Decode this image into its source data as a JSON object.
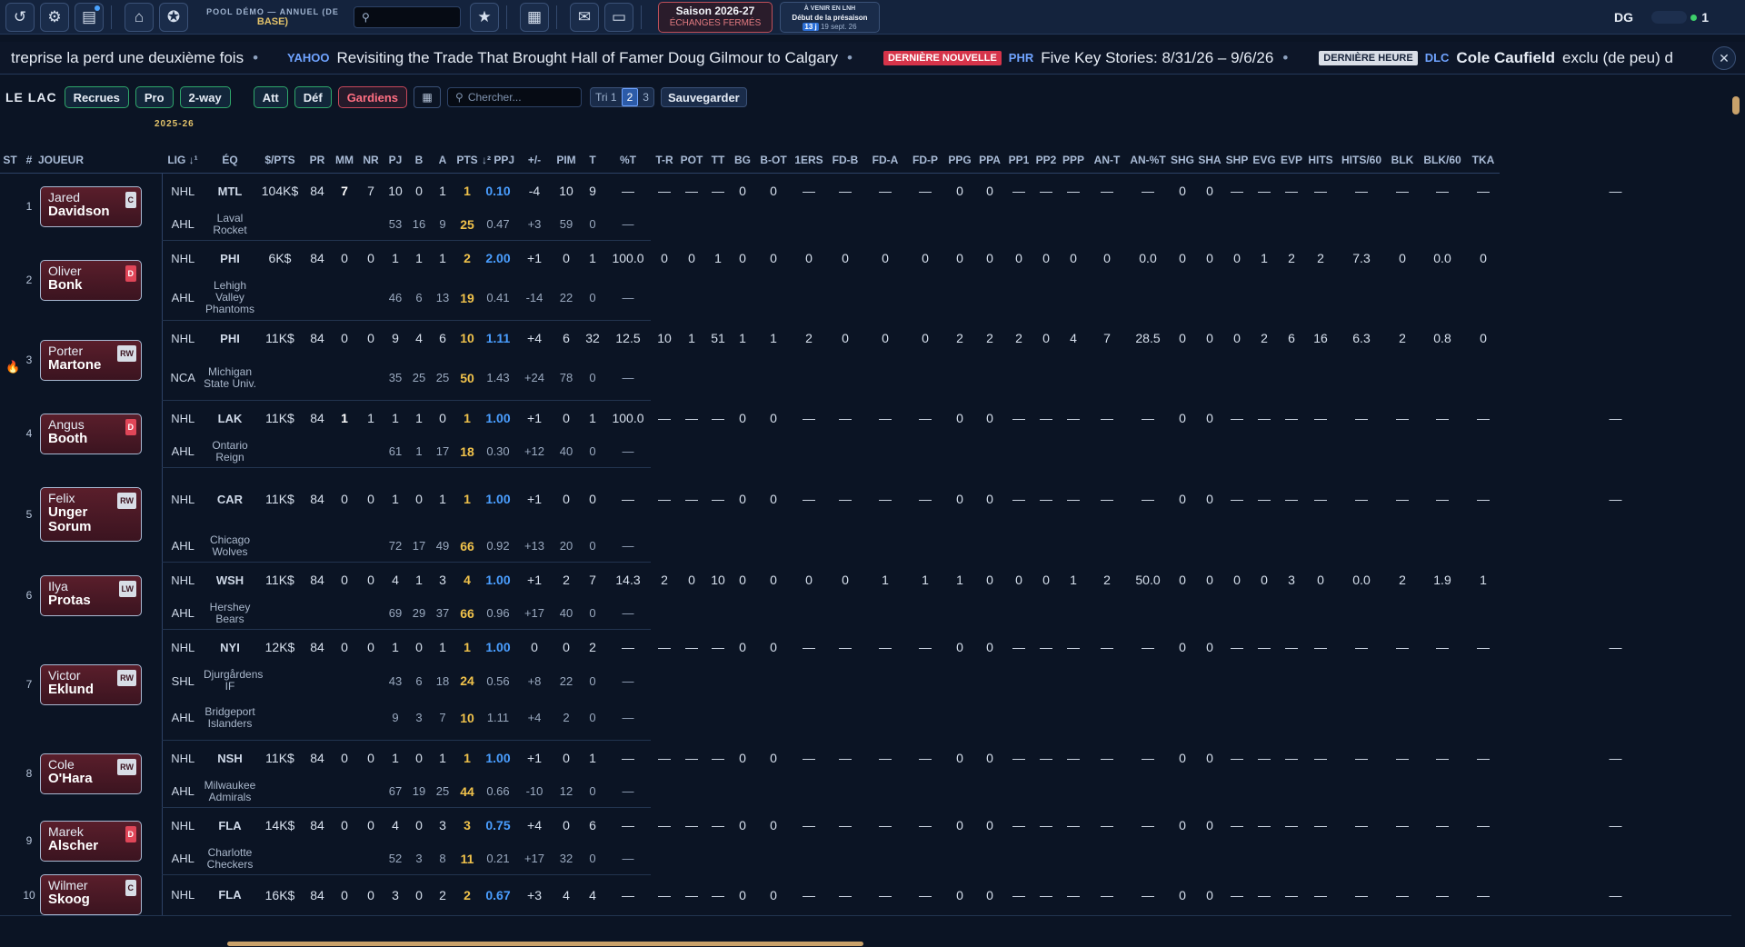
{
  "topbar": {
    "pool_line1": "POOL DÉMO — ANNUEL (DE",
    "pool_line2": "BASE)",
    "season_title": "Saison 2026-27",
    "season_status": "ÉCHANGES FERMÉS",
    "upcoming_title": "À VENIR EN LNH",
    "upcoming_event": "Début de la présaison",
    "upcoming_days": "13 j",
    "upcoming_date": "19 sept. 26",
    "user_initials": "DG",
    "user_count": "1"
  },
  "ticker": {
    "item1_text": "treprise la perd une deuxième fois",
    "item2_source": "YAHOO",
    "item2_text": "Revisiting the Trade That Brought Hall of Famer Doug Gilmour to Calgary",
    "item3_tag": "DERNIÈRE NOUVELLE",
    "item3_source": "PHR",
    "item3_text": "Five Key Stories: 8/31/26 – 9/6/26",
    "item4_tag": "DERNIÈRE HEURE",
    "item4_source": "DLC",
    "item4_bold": "Cole Caufield",
    "item4_text": "exclu (de peu) d"
  },
  "filters": {
    "team_name": "LE LAC",
    "recrues": "Recrues",
    "pro": "Pro",
    "two_way": "2-way",
    "att": "Att",
    "def": "Déf",
    "gardiens": "Gardiens",
    "search_placeholder": "Chercher...",
    "tri_label": "Tri 1",
    "tri2": "2",
    "tri3": "3",
    "save": "Sauvegarder",
    "season_label": "2025-26"
  },
  "columns": [
    "ST",
    "#",
    "JOUEUR",
    "LIG ↓¹",
    "ÉQ",
    "$/PTS",
    "PR",
    "MM",
    "NR",
    "PJ",
    "B",
    "A",
    "PTS",
    "↓² PPJ",
    "+/-",
    "PIM",
    "T",
    "%T",
    "T-R",
    "POT",
    "TT",
    "BG",
    "B-OT",
    "1ERS",
    "FD-B",
    "FD-A",
    "FD-P",
    "PPG",
    "PPA",
    "PP1",
    "PP2",
    "PPP",
    "AN-T",
    "AN-%T",
    "SHG",
    "SHA",
    "SHP",
    "EVG",
    "EVP",
    "HITS",
    "HITS/60",
    "BLK",
    "BLK/60",
    "TKA"
  ],
  "players": [
    {
      "num": "1",
      "first": "Jared",
      "last": "Davidson",
      "pos": "C",
      "rows": [
        {
          "lg": "NHL",
          "tm": "MTL",
          "c": [
            "104K$",
            "84",
            "7",
            "7",
            "10",
            "0",
            "1",
            "1",
            "0.10",
            "-4",
            "10",
            "9",
            "—",
            "—",
            "—",
            "—",
            "0",
            "0",
            "—",
            "—",
            "—",
            "—",
            "0",
            "0",
            "—",
            "—",
            "—",
            "—",
            "—",
            "0",
            "0",
            "—",
            "—",
            "—",
            "—",
            "—",
            "—",
            "—",
            "—",
            "—"
          ],
          "mmw": true
        },
        {
          "lg": "AHL",
          "tm": "Laval Rocket",
          "c": [
            "",
            "",
            "",
            "",
            "53",
            "16",
            "9",
            "25",
            "0.47",
            "+3",
            "59",
            "0",
            "—"
          ]
        }
      ]
    },
    {
      "num": "2",
      "first": "Oliver",
      "last": "Bonk",
      "pos": "D",
      "rows": [
        {
          "lg": "NHL",
          "tm": "PHI",
          "c": [
            "6K$",
            "84",
            "0",
            "0",
            "1",
            "1",
            "1",
            "2",
            "2.00",
            "+1",
            "0",
            "1",
            "100.0",
            "0",
            "0",
            "1",
            "0",
            "0",
            "0",
            "0",
            "0",
            "0",
            "0",
            "0",
            "0",
            "0",
            "0",
            "0",
            "0.0",
            "0",
            "0",
            "0",
            "1",
            "2",
            "2",
            "7.3",
            "0",
            "0.0",
            "0"
          ]
        },
        {
          "lg": "AHL",
          "tm": "Lehigh Valley Phantoms",
          "c": [
            "",
            "",
            "",
            "",
            "46",
            "6",
            "13",
            "19",
            "0.41",
            "-14",
            "22",
            "0",
            "—"
          ]
        }
      ]
    },
    {
      "num": "3",
      "first": "Porter",
      "last": "Martone",
      "pos": "RW",
      "fire": true,
      "rows": [
        {
          "lg": "NHL",
          "tm": "PHI",
          "c": [
            "11K$",
            "84",
            "0",
            "0",
            "9",
            "4",
            "6",
            "10",
            "1.11",
            "+4",
            "6",
            "32",
            "12.5",
            "10",
            "1",
            "51",
            "1",
            "1",
            "2",
            "0",
            "0",
            "0",
            "2",
            "2",
            "2",
            "0",
            "4",
            "7",
            "28.5",
            "0",
            "0",
            "0",
            "2",
            "6",
            "16",
            "6.3",
            "2",
            "0.8",
            "0"
          ]
        },
        {
          "lg": "NCA",
          "tm": "Michigan State Univ.",
          "c": [
            "",
            "",
            "",
            "",
            "35",
            "25",
            "25",
            "50",
            "1.43",
            "+24",
            "78",
            "0",
            "—"
          ]
        }
      ]
    },
    {
      "num": "4",
      "first": "Angus",
      "last": "Booth",
      "pos": "D",
      "rows": [
        {
          "lg": "NHL",
          "tm": "LAK",
          "c": [
            "11K$",
            "84",
            "1",
            "1",
            "1",
            "1",
            "0",
            "1",
            "1.00",
            "+1",
            "0",
            "1",
            "100.0",
            "—",
            "—",
            "—",
            "0",
            "0",
            "—",
            "—",
            "—",
            "—",
            "0",
            "0",
            "—",
            "—",
            "—",
            "—",
            "—",
            "0",
            "0",
            "—",
            "—",
            "—",
            "—",
            "—",
            "—",
            "—",
            "—",
            "—"
          ],
          "mmw": true
        },
        {
          "lg": "AHL",
          "tm": "Ontario Reign",
          "c": [
            "",
            "",
            "",
            "",
            "61",
            "1",
            "17",
            "18",
            "0.30",
            "+12",
            "40",
            "0",
            "—"
          ]
        }
      ]
    },
    {
      "num": "5",
      "first": "Felix",
      "last": "Unger Sorum",
      "pos": "RW",
      "tall": true,
      "rows": [
        {
          "lg": "NHL",
          "tm": "CAR",
          "c": [
            "11K$",
            "84",
            "0",
            "0",
            "1",
            "0",
            "1",
            "1",
            "1.00",
            "+1",
            "0",
            "0",
            "—",
            "—",
            "—",
            "—",
            "0",
            "0",
            "—",
            "—",
            "—",
            "—",
            "0",
            "0",
            "—",
            "—",
            "—",
            "—",
            "—",
            "0",
            "0",
            "—",
            "—",
            "—",
            "—",
            "—",
            "—",
            "—",
            "—",
            "—"
          ]
        },
        {
          "lg": "AHL",
          "tm": "Chicago Wolves",
          "c": [
            "",
            "",
            "",
            "",
            "72",
            "17",
            "49",
            "66",
            "0.92",
            "+13",
            "20",
            "0",
            "—"
          ]
        }
      ]
    },
    {
      "num": "6",
      "first": "Ilya",
      "last": "Protas",
      "pos": "LW",
      "rows": [
        {
          "lg": "NHL",
          "tm": "WSH",
          "c": [
            "11K$",
            "84",
            "0",
            "0",
            "4",
            "1",
            "3",
            "4",
            "1.00",
            "+1",
            "2",
            "7",
            "14.3",
            "2",
            "0",
            "10",
            "0",
            "0",
            "0",
            "0",
            "1",
            "1",
            "1",
            "0",
            "0",
            "0",
            "1",
            "2",
            "50.0",
            "0",
            "0",
            "0",
            "0",
            "3",
            "0",
            "0.0",
            "2",
            "1.9",
            "1"
          ]
        },
        {
          "lg": "AHL",
          "tm": "Hershey Bears",
          "c": [
            "",
            "",
            "",
            "",
            "69",
            "29",
            "37",
            "66",
            "0.96",
            "+17",
            "40",
            "0",
            "—"
          ]
        }
      ]
    },
    {
      "num": "7",
      "first": "Victor",
      "last": "Eklund",
      "pos": "RW",
      "rows": [
        {
          "lg": "NHL",
          "tm": "NYI",
          "c": [
            "12K$",
            "84",
            "0",
            "0",
            "1",
            "0",
            "1",
            "1",
            "1.00",
            "0",
            "0",
            "2",
            "—",
            "—",
            "—",
            "—",
            "0",
            "0",
            "—",
            "—",
            "—",
            "—",
            "0",
            "0",
            "—",
            "—",
            "—",
            "—",
            "—",
            "0",
            "0",
            "—",
            "—",
            "—",
            "—",
            "—",
            "—",
            "—",
            "—",
            "—"
          ]
        },
        {
          "lg": "SHL",
          "tm": "Djurgårdens IF",
          "c": [
            "",
            "",
            "",
            "",
            "43",
            "6",
            "18",
            "24",
            "0.56",
            "+8",
            "22",
            "0",
            "—"
          ]
        },
        {
          "lg": "AHL",
          "tm": "Bridgeport Islanders",
          "c": [
            "",
            "",
            "",
            "",
            "9",
            "3",
            "7",
            "10",
            "1.11",
            "+4",
            "2",
            "0",
            "—"
          ]
        }
      ]
    },
    {
      "num": "8",
      "first": "Cole",
      "last": "O'Hara",
      "pos": "RW",
      "rows": [
        {
          "lg": "NHL",
          "tm": "NSH",
          "c": [
            "11K$",
            "84",
            "0",
            "0",
            "1",
            "0",
            "1",
            "1",
            "1.00",
            "+1",
            "0",
            "1",
            "—",
            "—",
            "—",
            "—",
            "0",
            "0",
            "—",
            "—",
            "—",
            "—",
            "0",
            "0",
            "—",
            "—",
            "—",
            "—",
            "—",
            "0",
            "0",
            "—",
            "—",
            "—",
            "—",
            "—",
            "—",
            "—",
            "—",
            "—"
          ]
        },
        {
          "lg": "AHL",
          "tm": "Milwaukee Admirals",
          "c": [
            "",
            "",
            "",
            "",
            "67",
            "19",
            "25",
            "44",
            "0.66",
            "-10",
            "12",
            "0",
            "—"
          ]
        }
      ]
    },
    {
      "num": "9",
      "first": "Marek",
      "last": "Alscher",
      "pos": "D",
      "rows": [
        {
          "lg": "NHL",
          "tm": "FLA",
          "c": [
            "14K$",
            "84",
            "0",
            "0",
            "4",
            "0",
            "3",
            "3",
            "0.75",
            "+4",
            "0",
            "6",
            "—",
            "—",
            "—",
            "—",
            "0",
            "0",
            "—",
            "—",
            "—",
            "—",
            "0",
            "0",
            "—",
            "—",
            "—",
            "—",
            "—",
            "0",
            "0",
            "—",
            "—",
            "—",
            "—",
            "—",
            "—",
            "—",
            "—",
            "—"
          ]
        },
        {
          "lg": "AHL",
          "tm": "Charlotte Checkers",
          "c": [
            "",
            "",
            "",
            "",
            "52",
            "3",
            "8",
            "11",
            "0.21",
            "+17",
            "32",
            "0",
            "—"
          ]
        }
      ]
    },
    {
      "num": "10",
      "first": "Wilmer",
      "last": "Skoog",
      "pos": "C",
      "rows": [
        {
          "lg": "NHL",
          "tm": "FLA",
          "c": [
            "16K$",
            "84",
            "0",
            "0",
            "3",
            "0",
            "2",
            "2",
            "0.67",
            "+3",
            "4",
            "4",
            "—",
            "—",
            "—",
            "—",
            "0",
            "0",
            "—",
            "—",
            "—",
            "—",
            "0",
            "0",
            "—",
            "—",
            "—",
            "—",
            "—",
            "0",
            "0",
            "—",
            "—",
            "—",
            "—",
            "—",
            "—",
            "—",
            "—",
            "—"
          ]
        }
      ]
    }
  ]
}
